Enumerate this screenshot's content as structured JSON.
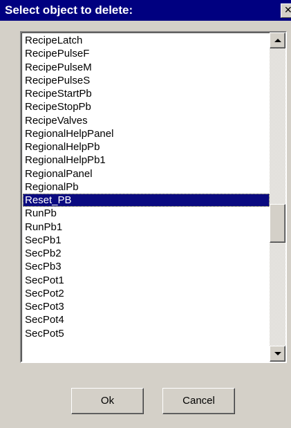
{
  "window": {
    "title": "Select object to delete:",
    "close_glyph": "✕"
  },
  "list": {
    "selected_index": 12,
    "items": [
      "RecipeLatch",
      "RecipePulseF",
      "RecipePulseM",
      "RecipePulseS",
      "RecipeStartPb",
      "RecipeStopPb",
      "RecipeValves",
      "RegionalHelpPanel",
      "RegionalHelpPb",
      "RegionalHelpPb1",
      "RegionalPanel",
      "RegionalPb",
      "Reset_PB",
      "RunPb",
      "RunPb1",
      "SecPb1",
      "SecPb2",
      "SecPb3",
      "SecPot1",
      "SecPot2",
      "SecPot3",
      "SecPot4",
      "SecPot5"
    ]
  },
  "buttons": {
    "ok_label": "Ok",
    "cancel_label": "Cancel"
  },
  "colors": {
    "titlebar": "#000080",
    "selection": "#0a0a80",
    "face": "#d4d0c8"
  },
  "icons": {
    "close": "close-icon",
    "scroll_up": "arrow-up-icon",
    "scroll_down": "arrow-down-icon"
  }
}
